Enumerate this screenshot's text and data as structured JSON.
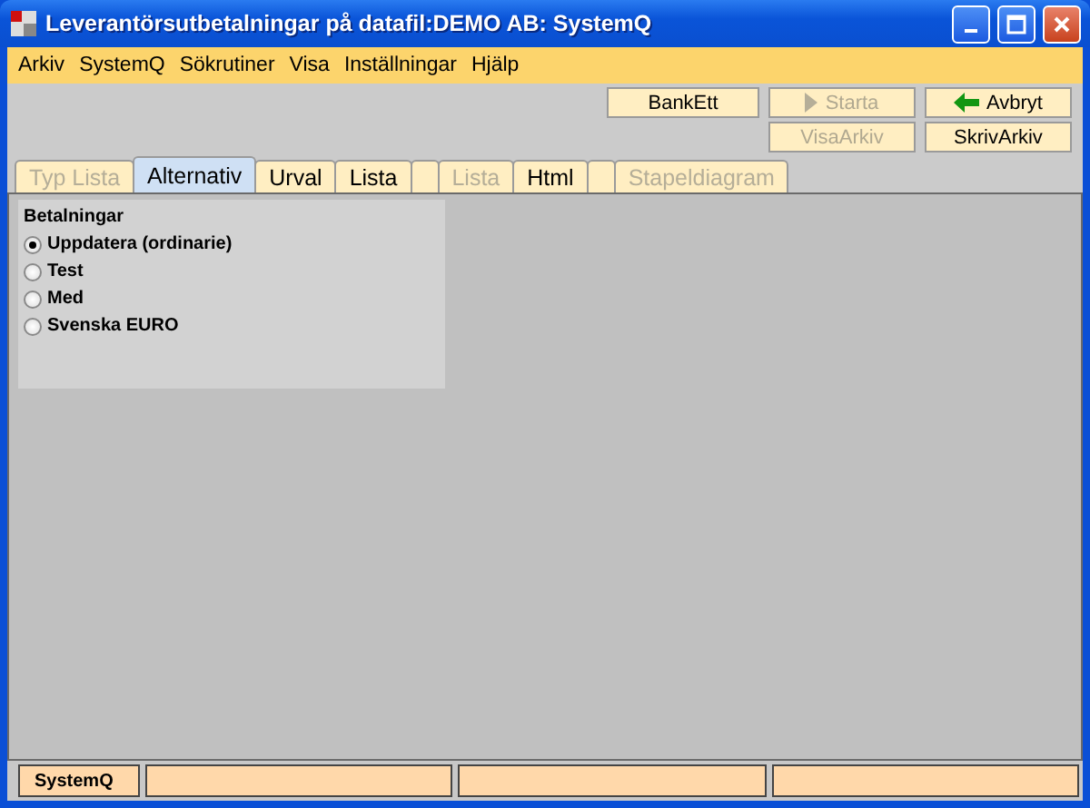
{
  "window": {
    "title": "Leverantörsutbetalningar på datafil:DEMO AB: SystemQ"
  },
  "menu": [
    {
      "label": "Arkiv"
    },
    {
      "label": "SystemQ"
    },
    {
      "label": "Sökrutiner"
    },
    {
      "label": "Visa"
    },
    {
      "label": "Inställningar"
    },
    {
      "label": "Hjälp"
    }
  ],
  "toolbar": [
    {
      "label": "BankEtt",
      "disabled": false,
      "kind": "plain"
    },
    {
      "label": "Starta",
      "disabled": true,
      "kind": "play"
    },
    {
      "label": "Avbryt",
      "disabled": false,
      "kind": "back"
    },
    {
      "label": "VisaArkiv",
      "disabled": true,
      "kind": "plain"
    },
    {
      "label": "SkrivArkiv",
      "disabled": false,
      "kind": "plain"
    }
  ],
  "tabs": [
    {
      "label": "Typ Lista",
      "selected": false,
      "disabled": true
    },
    {
      "label": "Alternativ",
      "selected": true,
      "disabled": false
    },
    {
      "label": "Urval",
      "selected": false,
      "disabled": false
    },
    {
      "label": "Lista",
      "selected": false,
      "disabled": false
    },
    {
      "selected": false
    },
    {
      "label": "Lista",
      "selected": false,
      "disabled": true
    },
    {
      "label": "Html",
      "selected": false,
      "disabled": false
    },
    {
      "selected": false
    },
    {
      "label": "Stapeldiagram",
      "selected": false,
      "disabled": true
    }
  ],
  "group": {
    "title": "Betalningar",
    "options": [
      {
        "label": "Uppdatera (ordinarie)",
        "selected": true
      },
      {
        "label": "Test",
        "selected": false
      },
      {
        "label": "Med",
        "selected": false
      },
      {
        "label": "Svenska EURO",
        "selected": false
      }
    ]
  },
  "status_bar": [
    {
      "text": "SystemQ"
    }
  ]
}
